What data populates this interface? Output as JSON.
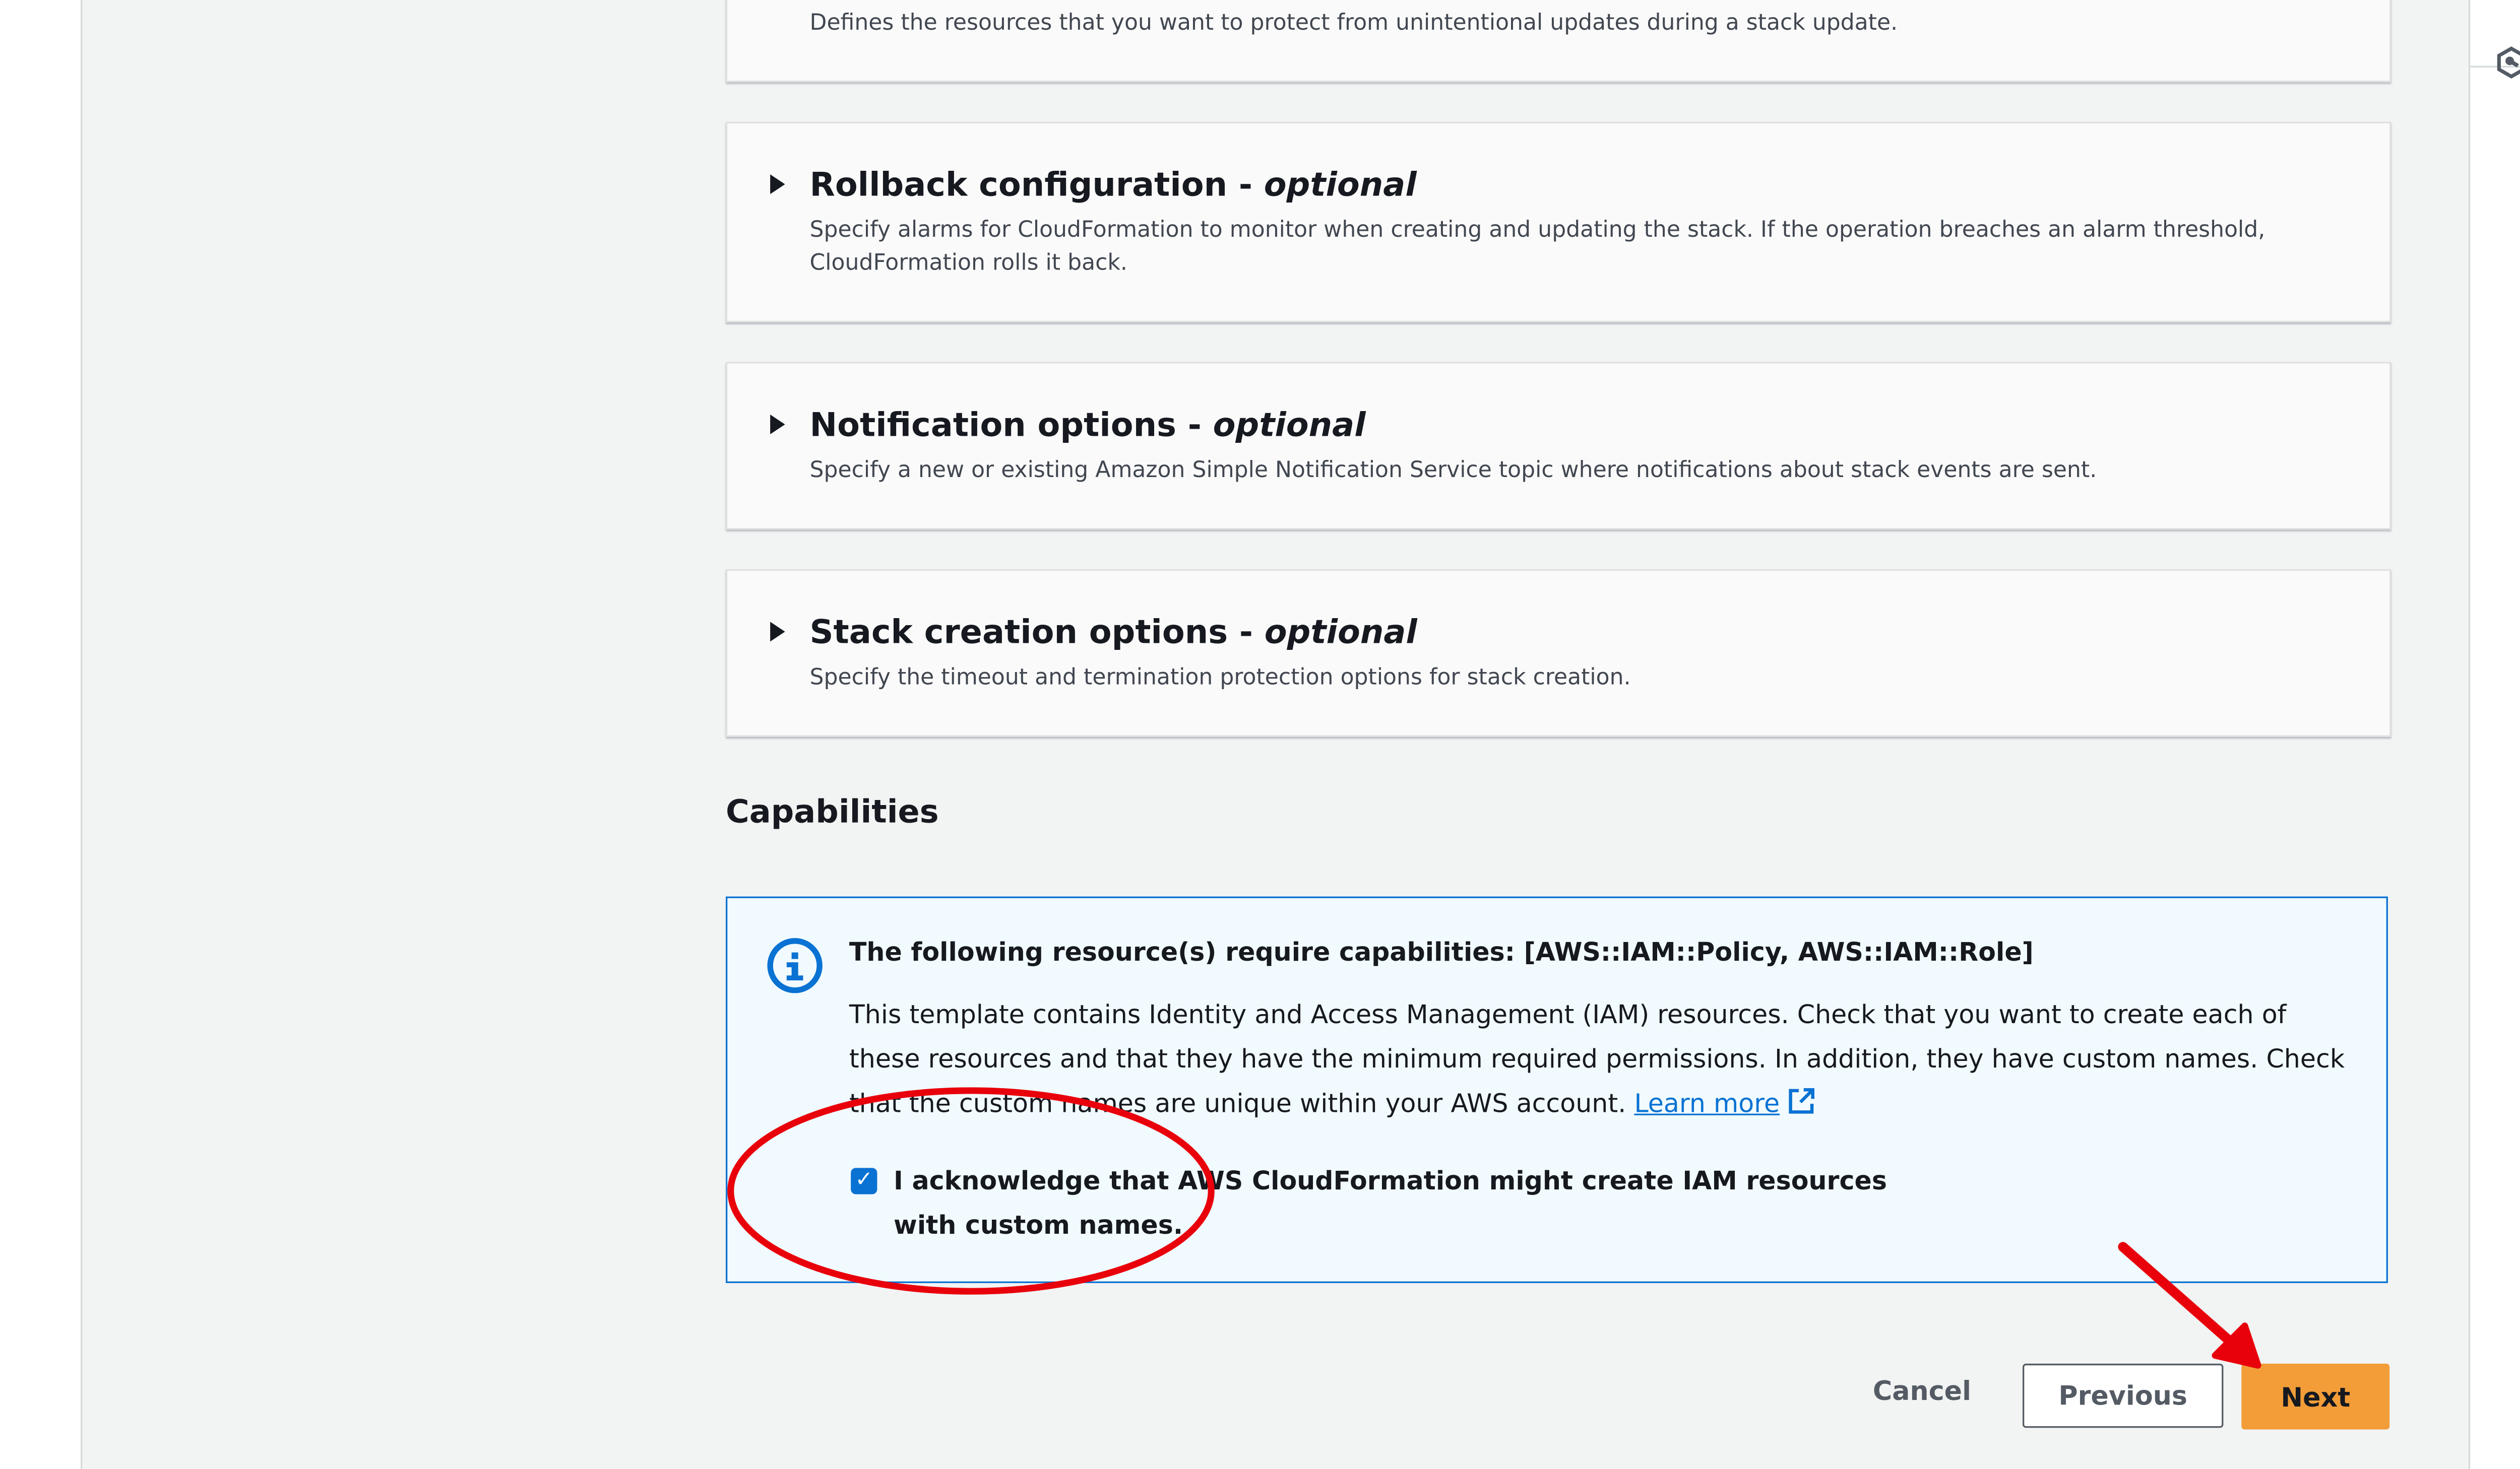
{
  "sections": [
    {
      "title": "",
      "optional": "",
      "description": "Defines the resources that you want to protect from unintentional updates during a stack update."
    },
    {
      "title": "Rollback configuration - ",
      "optional": "optional",
      "description": "Specify alarms for CloudFormation to monitor when creating and updating the stack. If the operation breaches an alarm threshold, CloudFormation rolls it back."
    },
    {
      "title": "Notification options - ",
      "optional": "optional",
      "description": "Specify a new or existing Amazon Simple Notification Service topic where notifications about stack events are sent."
    },
    {
      "title": "Stack creation options - ",
      "optional": "optional",
      "description": "Specify the timeout and termination protection options for stack creation."
    }
  ],
  "capabilities": {
    "heading": "Capabilities",
    "info_title": "The following resource(s) require capabilities: [AWS::IAM::Policy, AWS::IAM::Role]",
    "info_body": "This template contains Identity and Access Management (IAM) resources. Check that you want to create each of these resources and that they have the minimum required permissions. In addition, they have custom names. Check that the custom names are unique within your AWS account.",
    "learn_more": "Learn more",
    "acknowledge_label": "I acknowledge that AWS CloudFormation might create IAM resources with custom names.",
    "acknowledge_checked": true
  },
  "footer": {
    "cancel": "Cancel",
    "previous": "Previous",
    "next": "Next"
  },
  "colors": {
    "primary": "#f29d38",
    "link": "#0972d3",
    "info_bg": "#f1faff",
    "annotation": "#e8000b"
  },
  "icons": {
    "right_panel": "hexagon-tool-icon",
    "info": "info-icon",
    "external": "external-link-icon"
  }
}
